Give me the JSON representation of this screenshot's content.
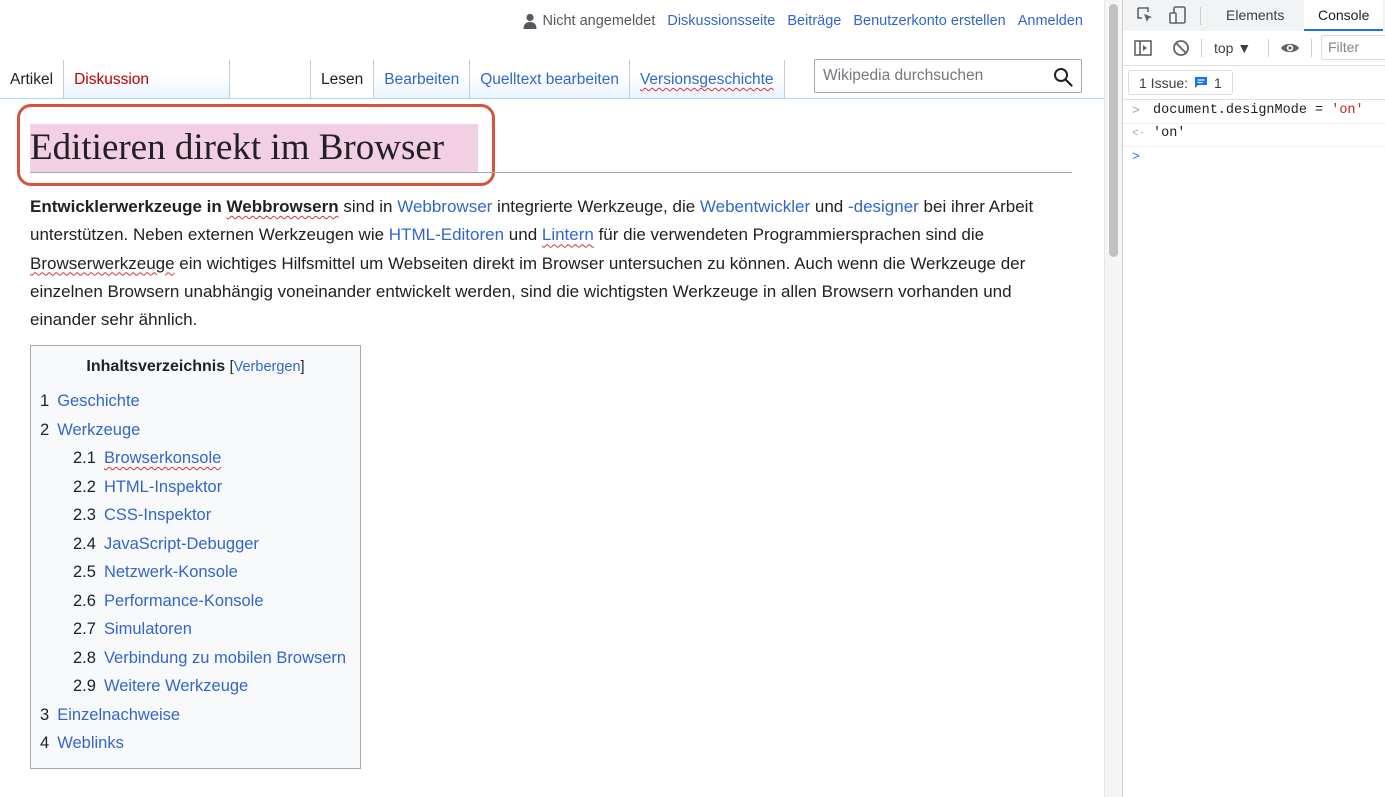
{
  "personal": {
    "anon": "Nicht angemeldet",
    "links": [
      "Diskussionsseite",
      "Beiträge",
      "Benutzerkonto erstellen",
      "Anmelden"
    ]
  },
  "tabs": {
    "article": "Artikel",
    "talk": "Diskussion",
    "read": "Lesen",
    "edit": "Bearbeiten",
    "edit_source": "Quelltext bearbeiten",
    "history": "Versionsgeschichte"
  },
  "search": {
    "placeholder": "Wikipedia durchsuchen"
  },
  "heading": "Editieren direkt im Browser",
  "intro": {
    "t0": "Entwicklerwerkzeuge in ",
    "t1": "Webbrowsern",
    "t2": " sind in ",
    "l1": "Webbrowser",
    "t3": " integrierte Werkzeuge, die ",
    "l2": "Webentwickler",
    "t4": " und ",
    "l3": "-designer",
    "t5": " bei ihrer Arbeit unterstützen. Neben externen Werkzeugen wie ",
    "l4": "HTML-Editoren",
    "t6": " und ",
    "l5": "Lintern",
    "t7": " für die verwendeten Programmiersprachen sind die ",
    "t8": "Browserwerkzeuge",
    "t9": " ein wichtiges Hilfsmittel um Webseiten direkt im Browser untersuchen zu können. Auch wenn die Werkzeuge der einzelnen Browsern unabhängig voneinander entwickelt werden, sind die wichtigsten Werkzeuge in allen Browsern vorhanden und einander sehr ähnlich."
  },
  "toc": {
    "title": "Inhaltsverzeichnis",
    "toggle_open": "[",
    "toggle": "Verbergen",
    "toggle_close": "]",
    "items": [
      {
        "num": "1",
        "label": "Geschichte"
      },
      {
        "num": "2",
        "label": "Werkzeuge"
      },
      {
        "num": "2.1",
        "label": "Browserkonsole"
      },
      {
        "num": "2.2",
        "label": "HTML-Inspektor"
      },
      {
        "num": "2.3",
        "label": "CSS-Inspektor"
      },
      {
        "num": "2.4",
        "label": "JavaScript-Debugger"
      },
      {
        "num": "2.5",
        "label": "Netzwerk-Konsole"
      },
      {
        "num": "2.6",
        "label": "Performance-Konsole"
      },
      {
        "num": "2.7",
        "label": "Simulatoren"
      },
      {
        "num": "2.8",
        "label": "Verbindung zu mobilen Browsern"
      },
      {
        "num": "2.9",
        "label": "Weitere Werkzeuge"
      },
      {
        "num": "3",
        "label": "Einzelnachweise"
      },
      {
        "num": "4",
        "label": "Weblinks"
      }
    ]
  },
  "devtools": {
    "tabs": [
      "Elements",
      "Console"
    ],
    "context": "top ▼",
    "filter_placeholder": "Filter",
    "issues_label": "1 Issue:",
    "issues_count": "1",
    "console": {
      "input_prompt": ">",
      "input_code": "document.designMode = ",
      "input_string": "'on'",
      "output_prompt": "<·",
      "output_value": "'on'",
      "empty_prompt": ">"
    }
  },
  "colors": {
    "link": "#3366cc",
    "redlink": "#ba0000",
    "heading_highlight": "#f3cfe3",
    "annotation_border": "#d6543e",
    "console_string": "#c5221f",
    "console_active_tab": "#1a73e8"
  },
  "icons": [
    "user-icon",
    "search-icon",
    "inspect-element-icon",
    "device-toolbar-icon",
    "sidebar-toggle-icon",
    "clear-console-icon",
    "eye-icon",
    "issue-message-icon"
  ]
}
